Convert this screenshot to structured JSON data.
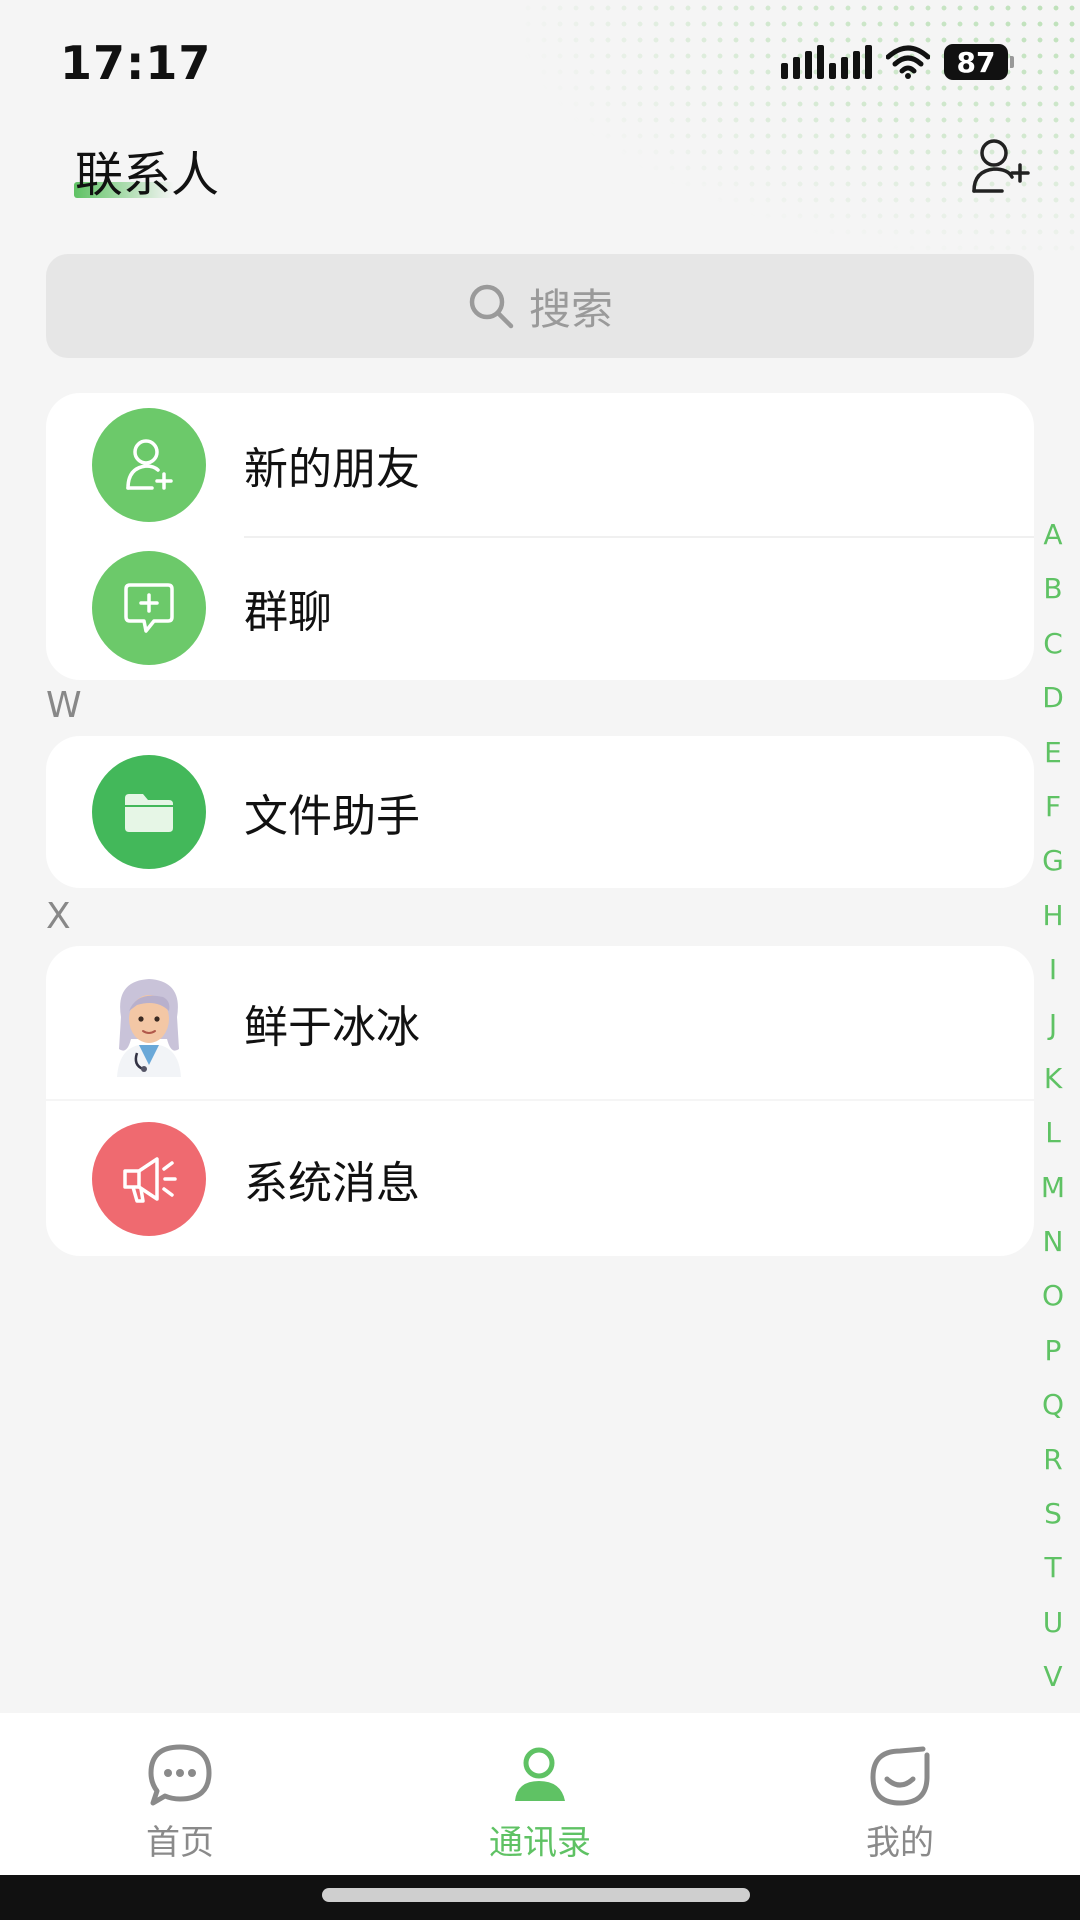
{
  "status_bar": {
    "time": "17:17",
    "battery": "87"
  },
  "header": {
    "title": "联系人"
  },
  "search": {
    "placeholder": "搜索"
  },
  "top_items": [
    {
      "label": "新的朋友",
      "icon": "add-user-icon",
      "color": "#6cc96a"
    },
    {
      "label": "群聊",
      "icon": "group-chat-icon",
      "color": "#6cc96a"
    }
  ],
  "sections": [
    {
      "letter": "W",
      "items": [
        {
          "label": "文件助手",
          "icon": "folder-icon",
          "color": "#43b85a"
        }
      ]
    },
    {
      "letter": "X",
      "items": [
        {
          "label": "鲜于冰冰",
          "icon": "avatar-doctor"
        },
        {
          "label": "系统消息",
          "icon": "megaphone-icon",
          "color": "#ef6a70"
        }
      ]
    }
  ],
  "alphabet": [
    "A",
    "B",
    "C",
    "D",
    "E",
    "F",
    "G",
    "H",
    "I",
    "J",
    "K",
    "L",
    "M",
    "N",
    "O",
    "P",
    "Q",
    "R",
    "S",
    "T",
    "U",
    "V"
  ],
  "tabs": [
    {
      "label": "首页",
      "icon": "chat-bubble-icon",
      "active": false
    },
    {
      "label": "通讯录",
      "icon": "contacts-icon",
      "active": true
    },
    {
      "label": "我的",
      "icon": "smile-icon",
      "active": false
    }
  ],
  "colors": {
    "accent": "#5fc264",
    "background": "#f5f5f5"
  }
}
